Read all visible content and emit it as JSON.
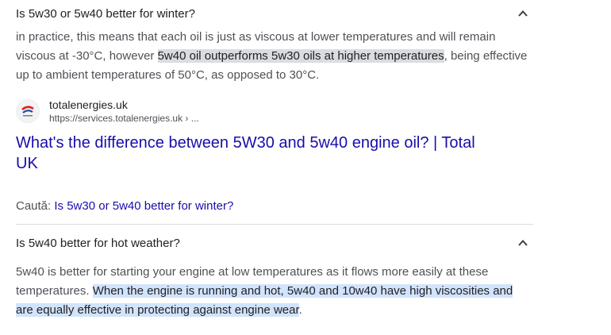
{
  "question1": {
    "text": "Is 5w30 or 5w40 better for winter?"
  },
  "snippet1": {
    "before": "in practice, this means that each oil is just as viscous at lower temperatures and will remain viscous at -30°C, however ",
    "highlight": "5w40 oil outperforms 5w30 oils at higher temperatures",
    "after": ", being effective up to ambient temperatures of 50°C, as opposed to 30°C."
  },
  "source": {
    "site_name": "totalenergies.uk",
    "url": "https://services.totalenergies.uk › ..."
  },
  "result": {
    "title": "What's the difference between 5W30 and 5w40 engine oil? | Total UK"
  },
  "search": {
    "label": "Caută: ",
    "query": "Is 5w30 or 5w40 better for winter?"
  },
  "question2": {
    "text": "Is 5w40 better for hot weather?"
  },
  "snippet2": {
    "before": "5w40 is better for starting your engine at low temperatures as it flows more easily at these temperatures. ",
    "highlight": "When the engine is running and hot, 5w40 and 10w40 have high viscosities and are equally effective in protecting against engine wear",
    "after": "."
  },
  "colors": {
    "link": "#1a0dab",
    "highlight_gray": "#dadce0",
    "highlight_blue": "#d2e3fc"
  }
}
